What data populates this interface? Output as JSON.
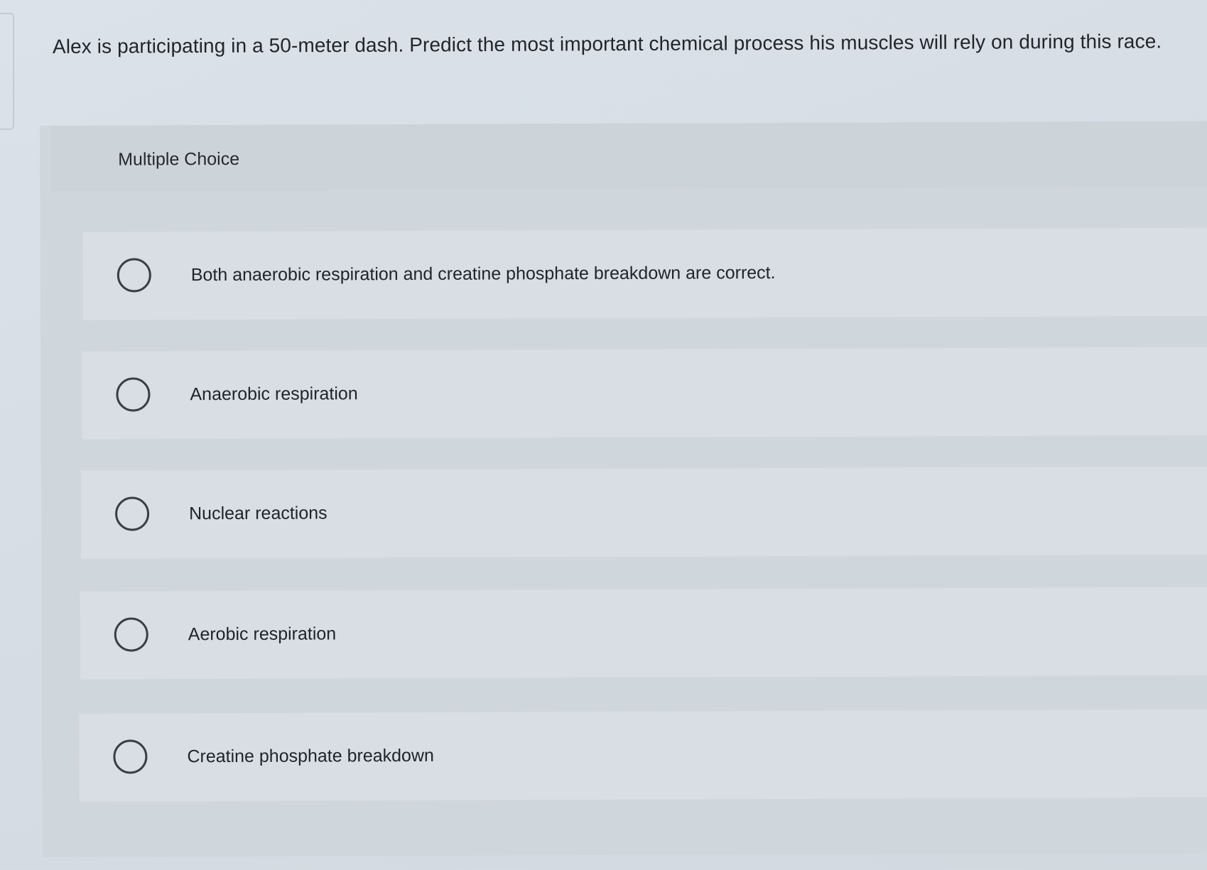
{
  "question": {
    "text": "Alex is participating in a 50-meter dash. Predict the most important chemical process his muscles will rely on during this race."
  },
  "multiple_choice": {
    "label": "Multiple Choice",
    "options": [
      {
        "label": "Both anaerobic respiration and creatine phosphate breakdown are correct.",
        "selected": false
      },
      {
        "label": "Anaerobic respiration",
        "selected": false
      },
      {
        "label": "Nuclear reactions",
        "selected": false
      },
      {
        "label": "Aerobic respiration",
        "selected": false
      },
      {
        "label": "Creatine phosphate breakdown",
        "selected": false
      }
    ]
  }
}
